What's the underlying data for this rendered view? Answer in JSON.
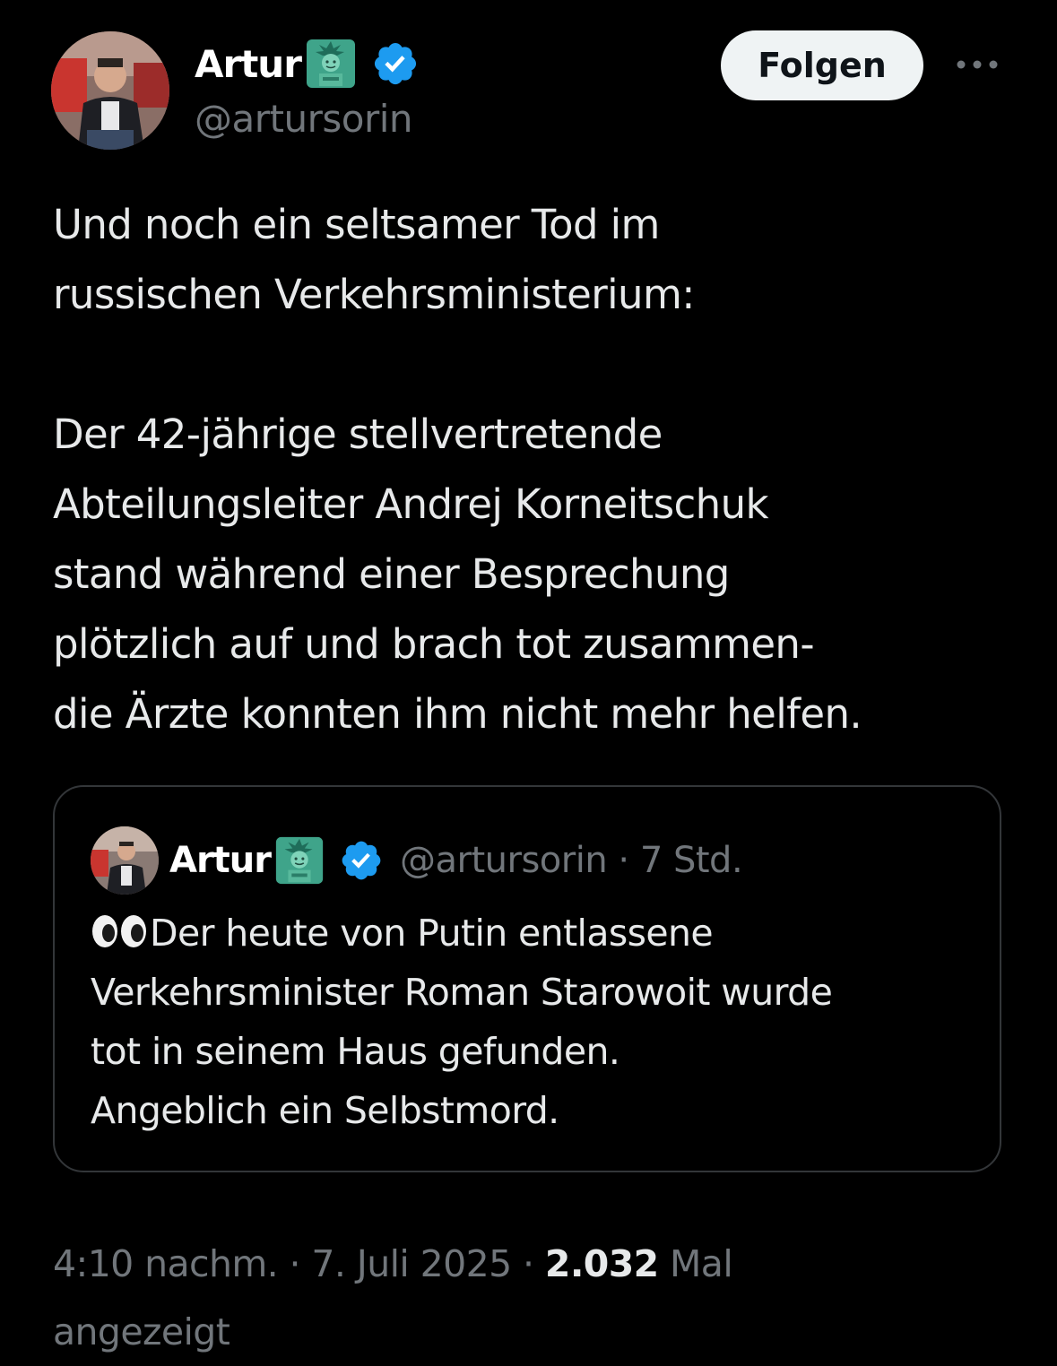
{
  "author": {
    "display_name": "Artur",
    "handle": "@artursorin",
    "icon_after_name": "statue-of-liberty-emoji",
    "verified_icon": "verified-badge-icon",
    "verified_color": "#1d9bf0"
  },
  "actions": {
    "follow_label": "Folgen",
    "more_icon": "more-options-icon"
  },
  "tweet": {
    "paragraph_1": "Und noch ein seltsamer Tod im\nrussischen Verkehrsministerium:",
    "paragraph_2": "Der 42-jährige stellvertretende\nAbteilungsleiter Andrej Korneitschuk\nstand während einer Besprechung\nplötzlich auf und brach tot zusammen-\ndie Ärzte konnten ihm nicht mehr helfen."
  },
  "quoted_tweet": {
    "display_name": "Artur",
    "handle_and_time": "@artursorin · 7 Std.",
    "leading_emoji": "eyes-emoji",
    "lines": [
      "Der heute von Putin entlassene",
      "Verkehrsminister Roman Starowoit wurde",
      "tot in seinem Haus gefunden.",
      "Angeblich ein Selbstmord."
    ]
  },
  "meta": {
    "timestamp": "4:10 nachm. · 7. Juli 2025 · ",
    "views_count": "2.032",
    "views_suffix": " Mal",
    "views_suffix_line2": "angezeigt"
  },
  "colors": {
    "background": "#000000",
    "text_primary": "#e7e9ea",
    "text_secondary": "#71767b",
    "border": "#333639",
    "follow_bg": "#eff3f4"
  }
}
